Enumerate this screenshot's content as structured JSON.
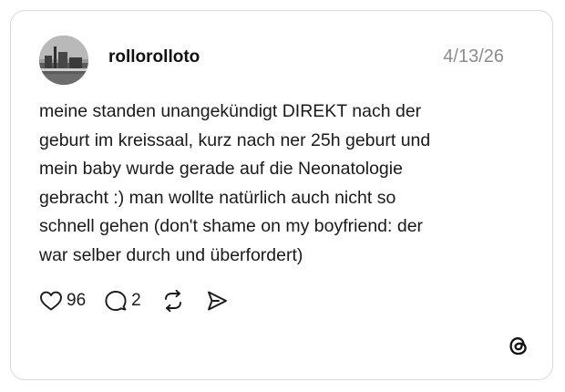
{
  "post": {
    "username": "rollorolloto",
    "date": "4/13/26",
    "text_lines": [
      "meine standen unangekündigt DIREKT nach der",
      "geburt im kreissaal, kurz nach ner 25h geburt und",
      "mein baby wurde gerade auf die Neonatologie",
      "gebracht :) man wollte natürlich auch nicht so",
      "schnell gehen (don't shame on my boyfriend: der",
      "war selber durch und überfordert)"
    ],
    "likes": "96",
    "replies": "2"
  },
  "icons": {
    "like": "heart-icon",
    "reply": "comment-bubble-icon",
    "repost": "repost-icon",
    "share": "send-icon",
    "brand": "threads-logo-icon"
  }
}
